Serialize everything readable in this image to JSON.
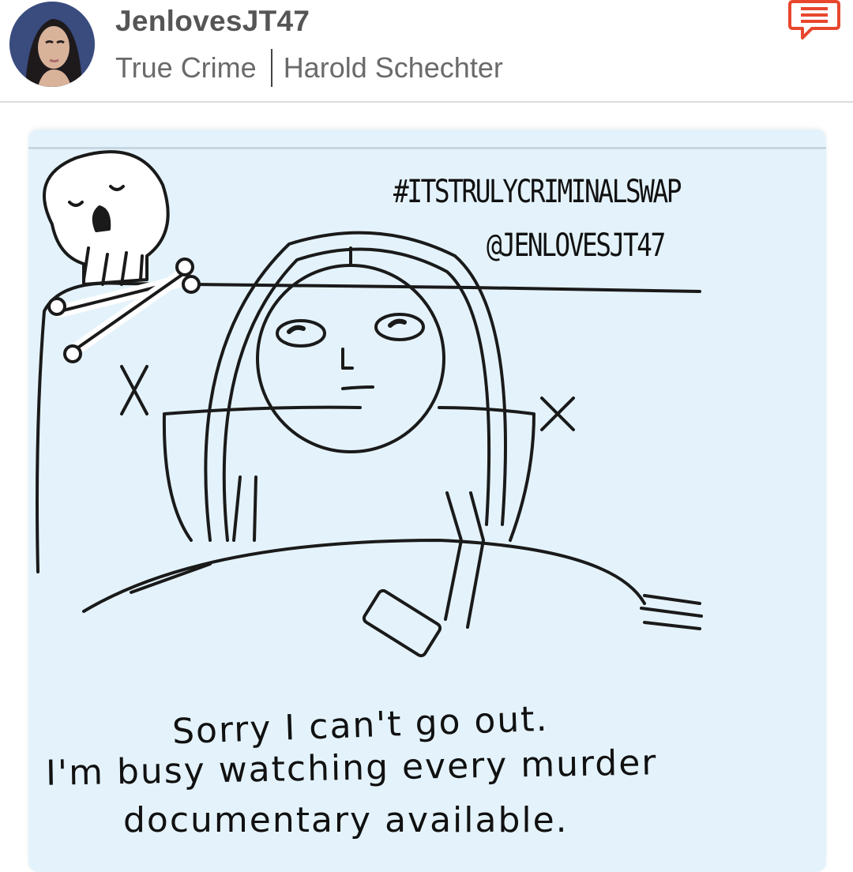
{
  "header": {
    "username": "JenlovesJT47",
    "category": "True Crime",
    "topic": "Harold Schechter"
  },
  "icons": {
    "avatar": "avatar",
    "chat": "chat-bubble-icon"
  },
  "colors": {
    "accent": "#e8472e",
    "card_background": "#e4f3fb"
  },
  "post": {
    "hashtag": "#ITSTRULYCRIMINALSWAP",
    "handle": "@JENLOVESJT47",
    "caption_line1": "Sorry I can't go out.",
    "caption_line2": "I'm busy watching every murder",
    "caption_line3": "documentary available."
  }
}
